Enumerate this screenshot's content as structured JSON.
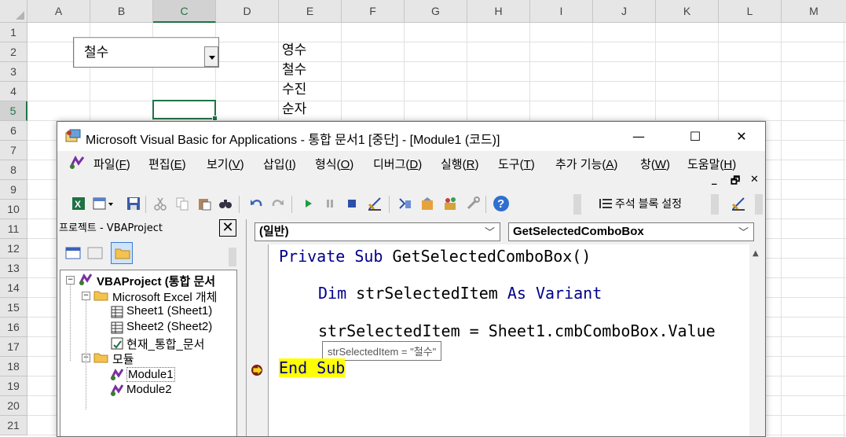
{
  "excel": {
    "columns": [
      "A",
      "B",
      "C",
      "D",
      "E",
      "F",
      "G",
      "H",
      "I",
      "J",
      "K",
      "L",
      "M"
    ],
    "rows": [
      "1",
      "2",
      "3",
      "4",
      "5",
      "6",
      "7",
      "8",
      "9",
      "10",
      "11",
      "12",
      "13",
      "14",
      "15",
      "16",
      "17",
      "18",
      "19",
      "20",
      "21"
    ],
    "selected_column": "C",
    "selected_row": "5",
    "cells": {
      "E2": "영수",
      "E3": "철수",
      "E4": "수진",
      "E5": "순자"
    },
    "combo_value": "철수"
  },
  "vbe": {
    "title": "Microsoft Visual Basic for Applications - 통합 문서1 [중단] - [Module1 (코드)]",
    "window_buttons": {
      "minimize": "—",
      "maximize": "☐",
      "close": "✕"
    },
    "menus": [
      {
        "label": "파일",
        "key": "F"
      },
      {
        "label": "편집",
        "key": "E"
      },
      {
        "label": "보기",
        "key": "V"
      },
      {
        "label": "삽입",
        "key": "I"
      },
      {
        "label": "형식",
        "key": "O"
      },
      {
        "label": "디버그",
        "key": "D"
      },
      {
        "label": "실행",
        "key": "R"
      },
      {
        "label": "도구",
        "key": "T"
      },
      {
        "label": "추가 기능",
        "key": "A"
      },
      {
        "label": "창",
        "key": "W"
      },
      {
        "label": "도움말",
        "key": "H"
      }
    ],
    "mdi_controls": {
      "minimize": "_",
      "restore": "🗗",
      "close": "✕"
    },
    "toolbar_comment_label": "주석 블록 설정",
    "project": {
      "title": "프로젝트 - VBAProject",
      "close_label": "✕",
      "tree": {
        "root": "VBAProject (통합 문서",
        "excel_objects": "Microsoft Excel 개체",
        "sheet1": "Sheet1 (Sheet1)",
        "sheet2": "Sheet2 (Sheet2)",
        "thisworkbook": "현재_통합_문서",
        "modules": "모듈",
        "module1": "Module1",
        "module2": "Module2"
      }
    },
    "code": {
      "object_dropdown": "(일반)",
      "proc_dropdown": "GetSelectedComboBox",
      "line1_kw": "Private Sub",
      "line1_rest": " GetSelectedComboBox()",
      "line2_kw1": "Dim",
      "line2_mid": " strSelectedItem ",
      "line2_kw2": "As Variant",
      "line3": "strSelectedItem = Sheet1.cmbComboBox.Value",
      "tooltip": "strSelectedItem = \"철수\"",
      "line4": "End Sub"
    }
  }
}
